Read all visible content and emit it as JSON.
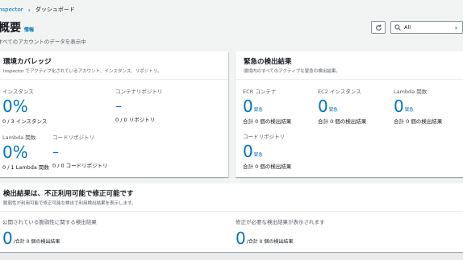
{
  "breadcrumb": {
    "parent": "Inspector",
    "separator": "›",
    "current": "ダッシュボード"
  },
  "header": {
    "title": "概要",
    "info": "情報",
    "subtitle": "すべてのアカウントのデータを表示中"
  },
  "toolbar": {
    "filter_value": "All"
  },
  "coverage": {
    "title": "環境カバレッジ",
    "description": "Inspector でアクティブ化されているアカウント、インスタンス、リポジトリ。",
    "instances": {
      "label": "インスタンス",
      "value": "0%",
      "sub": "0 / 3 インスタンス"
    },
    "container_repos": {
      "label": "コンテナリポジトリ",
      "value": "–",
      "sub": "0 / 0 リポジトリ"
    },
    "lambda": {
      "label": "Lambda 関数",
      "value": "0%",
      "sub": "0 / 1 Lambda 関数"
    },
    "code_repos": {
      "label": "コードリポジトリ",
      "value": "–",
      "sub": "0 / 0 コードリポジトリ"
    }
  },
  "critical": {
    "title": "緊急の検出結果",
    "description": "環境内のすべてのアクティブな緊急の検出結果。",
    "ecr": {
      "label": "ECR コンテナ",
      "value": "0",
      "tag": "緊急",
      "sub": "合計 0 個の検出結果"
    },
    "ec2": {
      "label": "EC2 インスタンス",
      "value": "0",
      "tag": "緊急",
      "sub": "合計 0 個の検出結果"
    },
    "lambda": {
      "label": "Lambda 関数",
      "value": "0",
      "tag": "緊急",
      "sub": "合計 0 個の検出結果"
    },
    "code_repo": {
      "label": "コードリポジトリ",
      "value": "0",
      "tag": "緊急",
      "sub": "合計 0 個の検出結果"
    }
  },
  "exploitable": {
    "title": "検出結果は、不正利用可能で修正可能です",
    "description": "脆弱性が利用可能で修正可能な検出で利用検出結果を表示します。",
    "public": {
      "label": "公開されている脆弱性に関する検出結果",
      "value": "0",
      "sub": "/合計 0 個の検出結果"
    },
    "fixable": {
      "label": "修正が必要な検出結果が表示されます",
      "value": "0",
      "sub": "/合計 0 個の検出結果"
    }
  }
}
